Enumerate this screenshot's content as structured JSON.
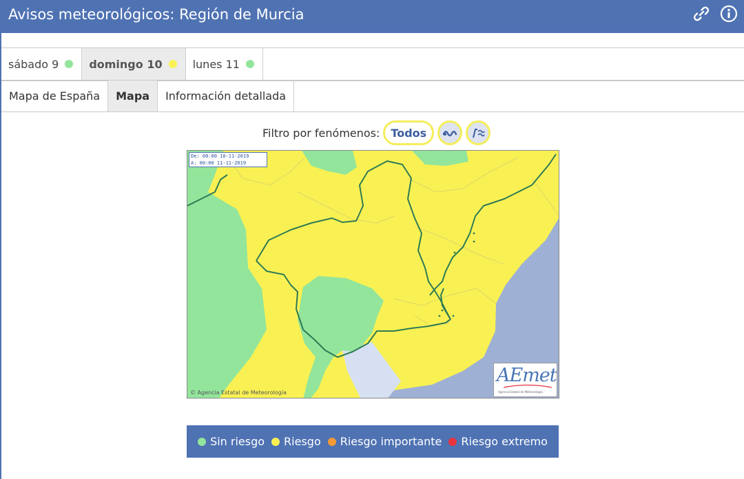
{
  "header": {
    "title": "Avisos meteorológicos: Región de Murcia",
    "link_icon": "link-icon",
    "info_icon": "info-icon"
  },
  "days": [
    {
      "label": "sábado 9",
      "status_color": "#92e59b",
      "active": false
    },
    {
      "label": "domingo 10",
      "status_color": "#f9f153",
      "active": true
    },
    {
      "label": "lunes 11",
      "status_color": "#92e59b",
      "active": false
    }
  ],
  "views": [
    {
      "label": "Mapa de España",
      "active": false
    },
    {
      "label": "Mapa",
      "active": true
    },
    {
      "label": "Información detallada",
      "active": false
    }
  ],
  "filter": {
    "label": "Filtro por fenómenos:",
    "all_label": "Todos",
    "icons": [
      "coastal-waves-icon",
      "storm-icon"
    ]
  },
  "map": {
    "date_from": "De: 00:00 10-11-2019",
    "date_to": "A:  00:00 11-11-2019",
    "copyright": "© Agencia Estatal de Meteorología",
    "logo_text": "AEmet",
    "logo_subtext": "Agencia Estatal de Meteorología"
  },
  "legend": [
    {
      "label": "Sin riesgo",
      "color": "#92e59b"
    },
    {
      "label": "Riesgo",
      "color": "#f9f153"
    },
    {
      "label": "Riesgo importante",
      "color": "#f39a36"
    },
    {
      "label": "Riesgo extremo",
      "color": "#e8343d"
    }
  ],
  "colors": {
    "header": "#4f72b3",
    "no_risk": "#92e59b",
    "risk": "#f9f153",
    "sea": "#9eb0d4"
  }
}
